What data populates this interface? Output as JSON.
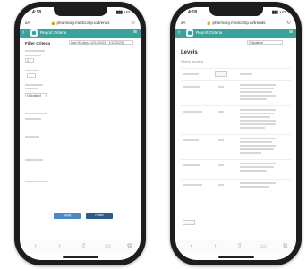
{
  "phones": [
    {
      "status_time": "4:18",
      "url": "🔒 pharmacy.medcomp.io/trends",
      "bar_title": "Report Criteria",
      "form_title": "Filter Criteria",
      "select_value": "Last 30 days (12/14/2021 - 1/12/2022)",
      "field_value": "1",
      "select_small": "Outpatient",
      "btn_apply": "Apply",
      "btn_reset": "Reset"
    },
    {
      "status_time": "4:18",
      "url": "🔒 pharmacy.medcomp.io/trends",
      "bar_title": "Report Criteria",
      "top_select": "Outpatient",
      "heading": "Levels",
      "sub": "Filters applied"
    }
  ],
  "colors": {
    "accent": "#39a39b",
    "apply": "#4a87c5",
    "reset": "#2f5b8a"
  }
}
